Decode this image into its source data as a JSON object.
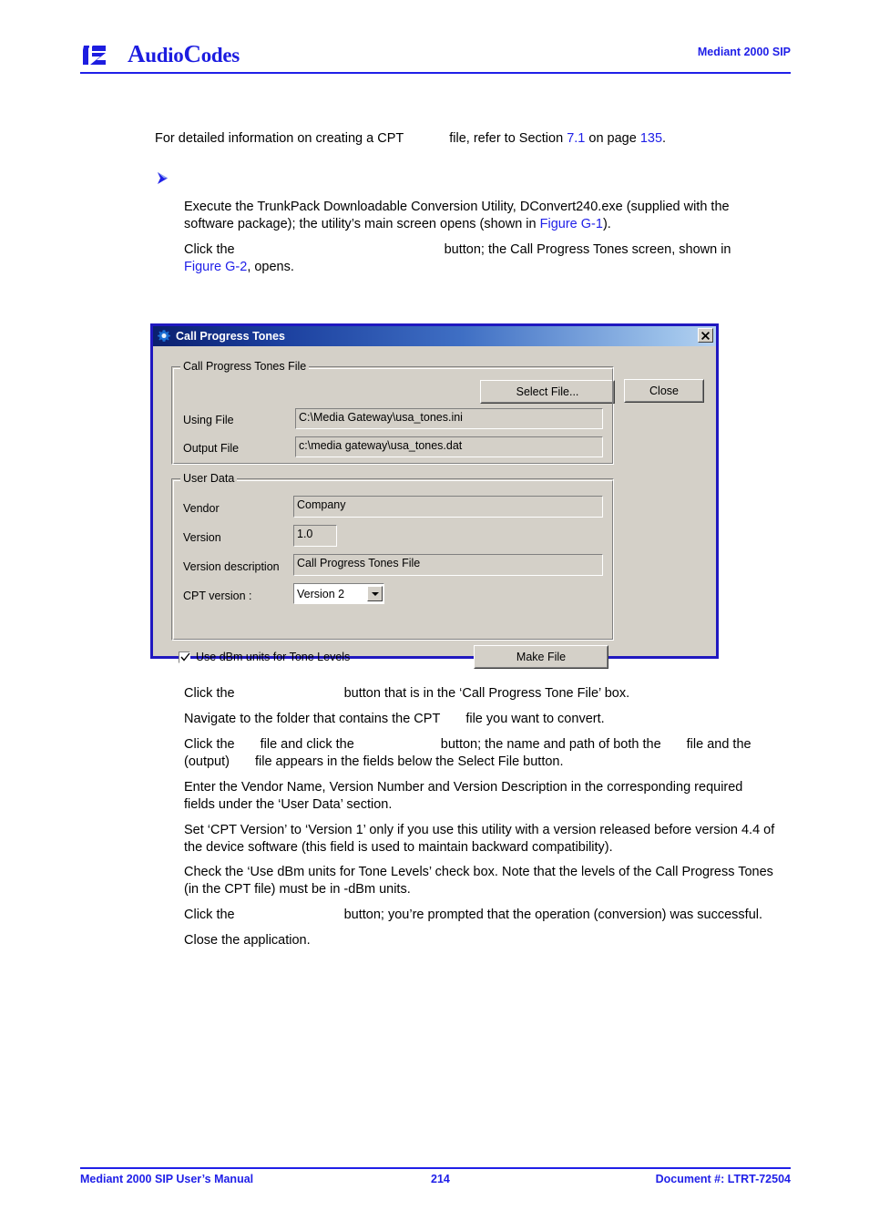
{
  "header": {
    "logo_text_prefix": "A",
    "logo_text_mid": "udio",
    "logo_text_cap2": "C",
    "logo_text_suffix": "odes",
    "logo_full": "AudioCodes",
    "product": "Mediant 2000 SIP"
  },
  "intro": {
    "line_a": "For detailed information on creating a CPT",
    "line_b": "file, refer to Section ",
    "section_link": "7.1",
    "line_c": " on page ",
    "page_link": "135",
    "line_d": "."
  },
  "steps_top": [
    {
      "text_a": "Execute the TrunkPack Downloadable Conversion Utility, DConvert240.exe (supplied with the software package); the utility’s main screen opens (shown in ",
      "link": "Figure G-1",
      "text_b": ")."
    },
    {
      "text_a": "Click the",
      "text_b": "button; the Call Progress Tones screen, shown in ",
      "link": "Figure G-2",
      "text_c": ", opens."
    }
  ],
  "dialog": {
    "title": "Call Progress Tones",
    "close_x": "✕",
    "close_button": "Close",
    "file_group": {
      "legend": "Call Progress Tones File",
      "select_button": "Select File...",
      "using_file_label": "Using File",
      "using_file_value": "C:\\Media Gateway\\usa_tones.ini",
      "output_file_label": "Output File",
      "output_file_value": "c:\\media gateway\\usa_tones.dat"
    },
    "user_group": {
      "legend": "User Data",
      "vendor_label": "Vendor",
      "vendor_value": "Company",
      "version_label": "Version",
      "version_value": "1.0",
      "version_desc_label": "Version description",
      "version_desc_value": "Call Progress Tones File",
      "cpt_version_label": "CPT version :",
      "cpt_version_value": "Version 2"
    },
    "checkbox_label": "Use dBm units for Tone Levels",
    "make_file_button": "Make File"
  },
  "steps_bottom": [
    {
      "text_a": "Click the",
      "text_b": "button that is in the ‘Call Progress Tone File’ box."
    },
    {
      "text_a": "Navigate to the folder that contains the CPT",
      "text_b": "file you want to convert."
    },
    {
      "text_a": "Click the",
      "text_b": "file and click the",
      "text_c": "button; the name and path of both the",
      "text_d": "file and the (output)",
      "text_e": "file appears in the fields below the Select File button."
    },
    {
      "text_a": "Enter the Vendor Name, Version Number and Version Description in the corresponding required fields under the ‘User Data’ section."
    },
    {
      "text_a": "Set ‘CPT Version’ to ‘Version 1’ only if you use this utility with a version released before version 4.4 of the device software (this field is used to maintain backward compatibility)."
    },
    {
      "text_a": "Check the ‘Use dBm units for Tone Levels’ check box. Note that the levels of the Call Progress Tones (in the CPT file) must be in -dBm units."
    },
    {
      "text_a": "Click the",
      "text_b": "button; you’re prompted that the operation (conversion) was successful."
    },
    {
      "text_a": "Close the application."
    }
  ],
  "footer": {
    "left": "Mediant 2000 SIP User’s Manual",
    "page": "214",
    "right": "Document #: LTRT-72504"
  },
  "colors": {
    "brand_blue": "#2020e8",
    "dialog_face": "#d4d0c8",
    "title_dark": "#0a1f6e",
    "title_light": "#b6d2f0"
  }
}
